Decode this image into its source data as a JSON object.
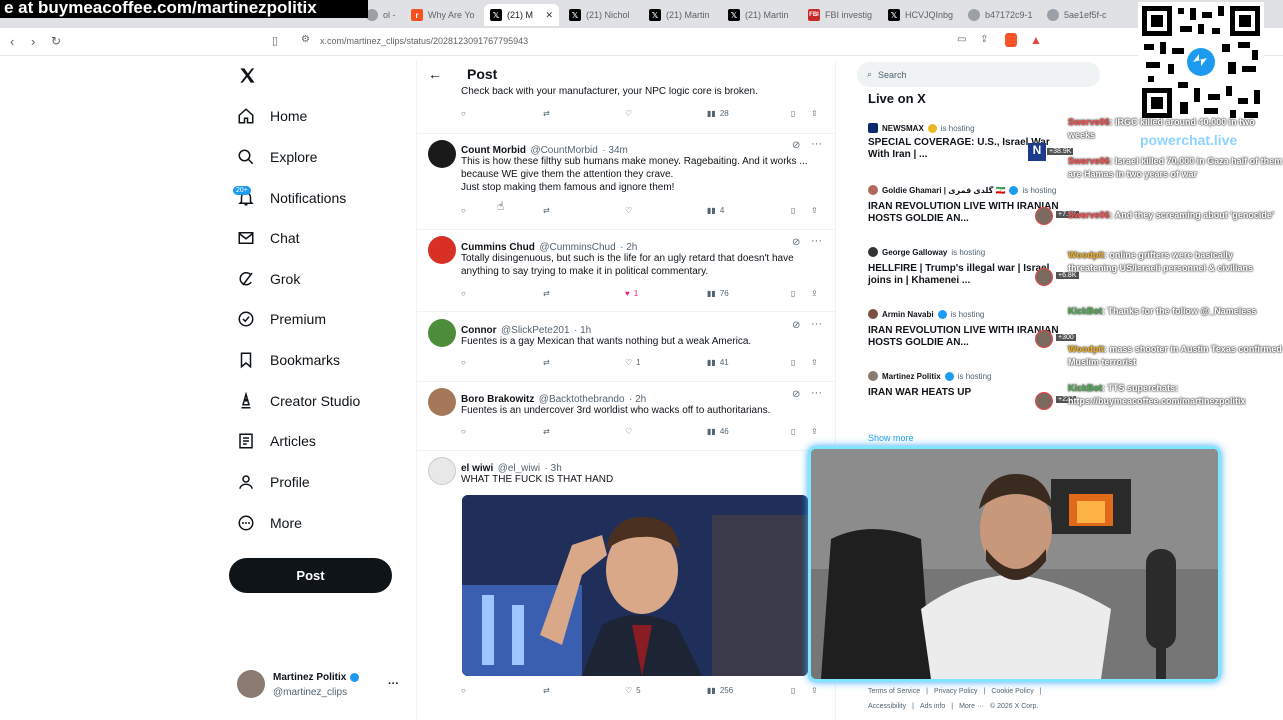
{
  "banner": {
    "text": "e at buymeacoffee.com/martinezpolitix"
  },
  "browser": {
    "tabs": [
      {
        "label": "ol -",
        "icon": "generic",
        "active": false
      },
      {
        "label": "Why Are Yo",
        "icon": "r",
        "active": false
      },
      {
        "label": "(21) M",
        "icon": "x",
        "active": true
      },
      {
        "label": "(21) Nichol",
        "icon": "x",
        "active": false
      },
      {
        "label": "(21) Martin",
        "icon": "x",
        "active": false
      },
      {
        "label": "(21) Martin",
        "icon": "x",
        "active": false
      },
      {
        "label": "FBI investig",
        "icon": "fbi",
        "active": false
      },
      {
        "label": "HCVJQInbg",
        "icon": "x",
        "active": false
      },
      {
        "label": "b47172c9-1",
        "icon": "generic",
        "active": false
      },
      {
        "label": "5ae1ef5f-c",
        "icon": "generic",
        "active": false
      }
    ],
    "url": "x.com/martinez_clips/status/2028123091767795943"
  },
  "nav": {
    "items": [
      {
        "label": "Home",
        "icon": "home-icon"
      },
      {
        "label": "Explore",
        "icon": "search-icon"
      },
      {
        "label": "Notifications",
        "icon": "bell-icon"
      },
      {
        "label": "Chat",
        "icon": "mail-icon"
      },
      {
        "label": "Grok",
        "icon": "grok-icon"
      },
      {
        "label": "Premium",
        "icon": "premium-icon"
      },
      {
        "label": "Bookmarks",
        "icon": "bookmark-icon"
      },
      {
        "label": "Creator Studio",
        "icon": "creator-icon"
      },
      {
        "label": "Articles",
        "icon": "articles-icon"
      },
      {
        "label": "Profile",
        "icon": "person-icon"
      },
      {
        "label": "More",
        "icon": "more-icon"
      }
    ],
    "notifications_badge": "20+",
    "post_button": "Post",
    "account": {
      "name": "Martinez Politix",
      "handle": "@martinez_clips",
      "more": "···"
    }
  },
  "header": {
    "title": "Post"
  },
  "top_reply": {
    "text": "Check back with your manufacturer, your NPC logic core is broken.",
    "views": "28"
  },
  "replies": [
    {
      "name": "Count Morbid",
      "handle": "@CountMorbid",
      "time": "· 34m",
      "text": "This is how these filthy sub humans make money. Ragebaiting. And it works ... because WE give them the attention they crave.\nJust stop making them famous and ignore them!",
      "reply_count": "",
      "repost_count": "",
      "likes": "",
      "views": "4",
      "liked": false
    },
    {
      "name": "Cummins Chud",
      "handle": "@CumminsChud",
      "time": "· 2h",
      "text": "Totally disingenuous, but such is the life for an ugly retard that doesn't have anything to say trying to make it in political commentary.",
      "likes": "1",
      "views": "76",
      "liked": true
    },
    {
      "name": "Connor",
      "handle": "@SlickPete201",
      "time": "· 1h",
      "text": "Fuentes is a gay Mexican that wants nothing but a weak America.",
      "likes": "1",
      "views": "41",
      "liked": false
    },
    {
      "name": "Boro Brakowitz",
      "handle": "@Backtothebrando",
      "time": "· 2h",
      "text": "Fuentes is an undercover 3rd worldist who wacks off to authoritarians.",
      "likes": "",
      "views": "46",
      "liked": false
    },
    {
      "name": "el wiwi",
      "handle": "@el_wiwi",
      "time": "· 3h",
      "text": "WHAT THE FUCK IS THAT HAND",
      "likes": "5",
      "views": "256",
      "liked": false
    }
  ],
  "right": {
    "search_placeholder": "Search",
    "live_heading": "Live on X",
    "live": [
      {
        "host": "NEWSMAX",
        "status": "is hosting",
        "title": "SPECIAL COVERAGE: U.S., Israel War With Iran | ...",
        "badge": "gold"
      },
      {
        "host": "Goldie Ghamari | گلدی قمری 🇮🇷",
        "status": "is hosting",
        "title": "IRAN REVOLUTION LIVE WITH IRANIAN HOSTS GOLDIE AN...",
        "badge": "blue"
      },
      {
        "host": "George Galloway",
        "status": "is hosting",
        "title": "HELLFIRE | Trump's illegal war | Israel joins in | Khamenei ...",
        "badge": "none"
      },
      {
        "host": "Armin Navabi",
        "status": "is hosting",
        "title": "IRAN REVOLUTION LIVE WITH IRANIAN HOSTS GOLDIE AN...",
        "badge": "blue"
      },
      {
        "host": "Martinez Politix",
        "status": "is hosting",
        "title": "IRAN WAR HEATS UP",
        "badge": "blue"
      }
    ],
    "show_more": "Show more",
    "footer": [
      "Terms of Service",
      "|",
      "Privacy Policy",
      "|",
      "Cookie Policy",
      "|",
      "Accessibility",
      "|",
      "Ads info",
      "|",
      "More ···",
      "© 2026 X Corp."
    ]
  },
  "chat": {
    "lines": [
      {
        "user": "Swerve06",
        "text": ": IRGC killed around 40,000 in two weeks"
      },
      {
        "user": "Swerve06",
        "text": ": Israel killed 70,000 in Gaza half of them are Hamas in two years of war"
      },
      {
        "user": "Swerve06",
        "text": ": And they screaming about 'genocide'"
      },
      {
        "user": "Woodpit",
        "text": ": online grifters were basically threatening US/Israeli personnel & civilians"
      },
      {
        "user": "KickBot",
        "text": ": Thanks for the follow @_Nameless"
      },
      {
        "user": "Woodpit",
        "text": ": mass shooter in Austin Texas confirmed Muslim terrorist"
      },
      {
        "user": "KickBot",
        "text": ": TTS superchats: https://buymeacoffee.com/martinezpolitix"
      }
    ],
    "counts": [
      "+38.9K",
      "+7.9K",
      "+6.8K",
      "+300",
      "+227"
    ],
    "powerchat": "powerchat.live"
  },
  "colors": {
    "accent": "#1d9bf0",
    "like": "#f91880",
    "dark": "#0f1419",
    "muted": "#536471"
  }
}
